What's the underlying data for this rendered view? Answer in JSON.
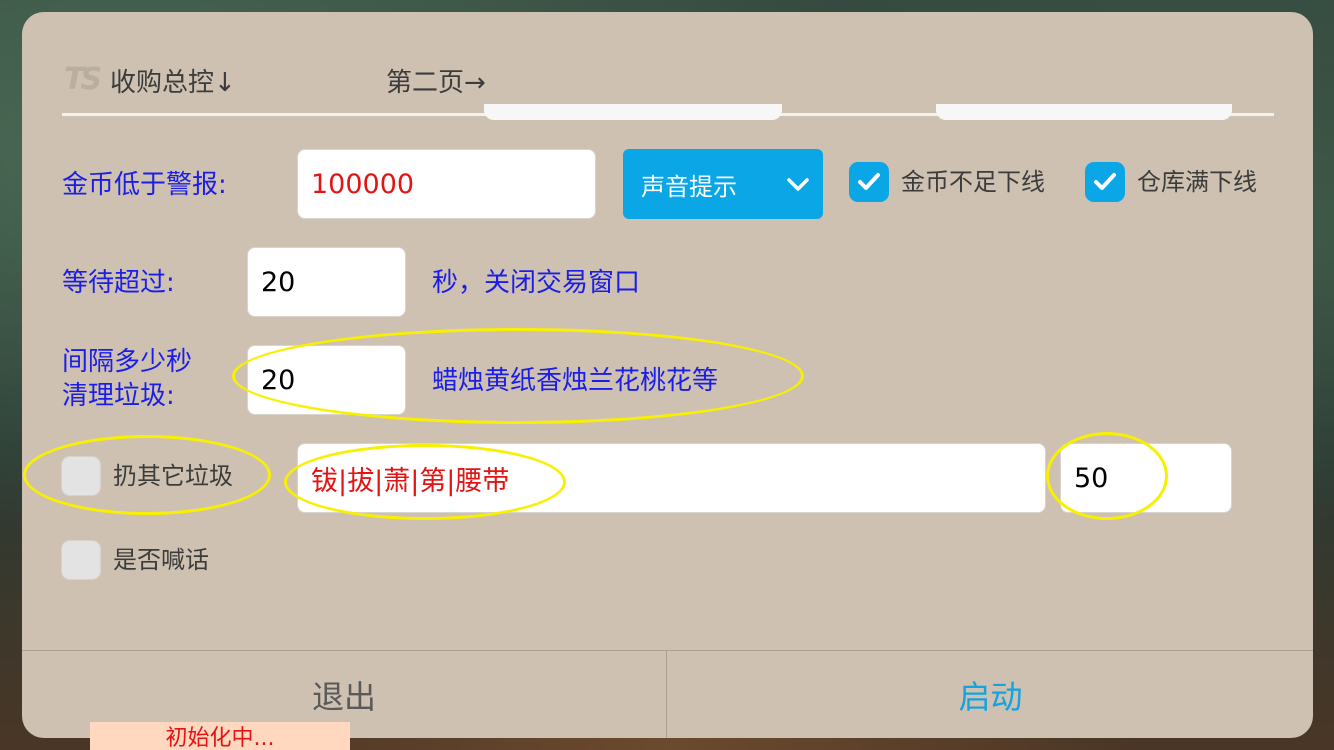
{
  "tabs": [
    {
      "label": "收购总控↓"
    },
    {
      "label": "第二页→"
    }
  ],
  "gold_alarm": {
    "label": "金币低于警报:",
    "value": "100000",
    "select_value": "声音提示",
    "logout_gold_label": "金币不足下线",
    "logout_gold_checked": true,
    "logout_warehouse_label": "仓库满下线",
    "logout_warehouse_checked": true
  },
  "wait": {
    "label": "等待超过:",
    "value": "20",
    "suffix": "秒，关闭交易窗口"
  },
  "cleanup": {
    "label_line1": "间隔多少秒",
    "label_line2": "清理垃圾:",
    "value": "20",
    "hint": "蜡烛黄纸香烛兰花桃花等"
  },
  "discard_other": {
    "label": "扔其它垃圾",
    "checked": false,
    "items_value": "钹|拔|萧|第|腰带",
    "count_value": "50"
  },
  "shout": {
    "label": "是否喊话",
    "checked": false
  },
  "footer": {
    "quit_label": "退出",
    "start_label": "启动"
  },
  "status": "初始化中...",
  "colors": {
    "dialog_bg": "#cec1b1",
    "accent": "#0aa6e6",
    "label_blue": "#1a1ee8",
    "value_red": "#e21414",
    "highlight": "#f8f000"
  }
}
